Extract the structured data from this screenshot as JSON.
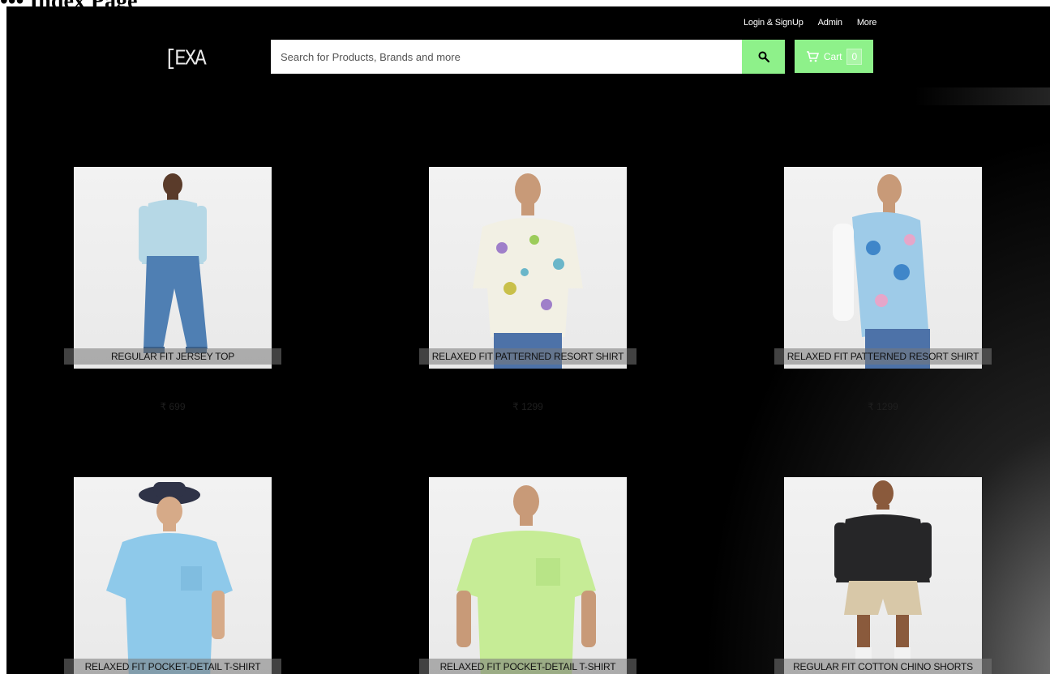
{
  "doc_heading": "••• Index Page",
  "nav": {
    "login": "Login & SignUp",
    "admin": "Admin",
    "more": "More"
  },
  "logo": "[EXA",
  "search": {
    "placeholder": "Search for Products, Brands and more",
    "value": ""
  },
  "cart": {
    "label": "Cart",
    "count": "0"
  },
  "colors": {
    "accent": "#8ef18a",
    "background": "#000000"
  },
  "icons": {
    "search": "search-icon",
    "cart": "cart-icon"
  },
  "products": [
    {
      "title": "REGULAR FIT JERSEY TOP",
      "price": "₹ 699"
    },
    {
      "title": "RELAXED FIT PATTERNED RESORT SHIRT",
      "price": "₹ 1299"
    },
    {
      "title": "RELAXED FIT PATTERNED RESORT SHIRT",
      "price": "₹ 1299"
    },
    {
      "title": "RELAXED FIT POCKET-DETAIL T-SHIRT",
      "price": ""
    },
    {
      "title": "RELAXED FIT POCKET-DETAIL T-SHIRT",
      "price": ""
    },
    {
      "title": "REGULAR FIT COTTON CHINO SHORTS",
      "price": ""
    }
  ]
}
